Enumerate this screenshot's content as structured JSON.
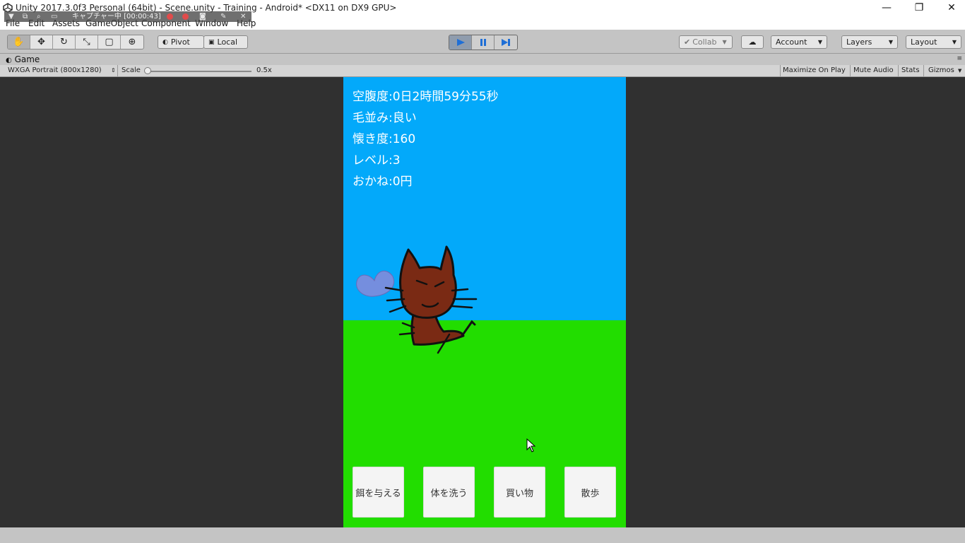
{
  "window": {
    "title": "Unity 2017.3.0f3 Personal (64bit) - Scene.unity - Training - Android* <DX11 on DX9 GPU>",
    "minimize": "—",
    "maximize": "❐",
    "close": "✕"
  },
  "capture": {
    "label": "キャプチャー中 [00:00:43]"
  },
  "menu": {
    "items": [
      "File",
      "Edit",
      "Assets",
      "GameObject",
      "Component",
      "Window",
      "Help"
    ]
  },
  "toolbar": {
    "pivot_label": "Pivot",
    "local_label": "Local",
    "collab_label": "Collab",
    "account_label": "Account",
    "layers_label": "Layers",
    "layout_label": "Layout"
  },
  "game_tab": {
    "label": "Game",
    "resolution": "WXGA Portrait (800x1280)",
    "scale_label": "Scale",
    "scale_value": "0.5x",
    "scale_level": 0.0,
    "maximize_on_play": "Maximize On Play",
    "mute_audio": "Mute Audio",
    "stats": "Stats",
    "gizmos": "Gizmos"
  },
  "game": {
    "stats": [
      "空腹度:0日2時間59分55秒",
      "毛並み:良い",
      "懐き度:160",
      "レベル:3",
      "おかね:0円"
    ],
    "buttons": [
      "餌を与える",
      "体を洗う",
      "買い物",
      "散歩"
    ],
    "colors": {
      "sky": "#03a9fa",
      "grass": "#22dd00",
      "cat": "#7a2a14",
      "wing": "#8a8ad8"
    }
  }
}
